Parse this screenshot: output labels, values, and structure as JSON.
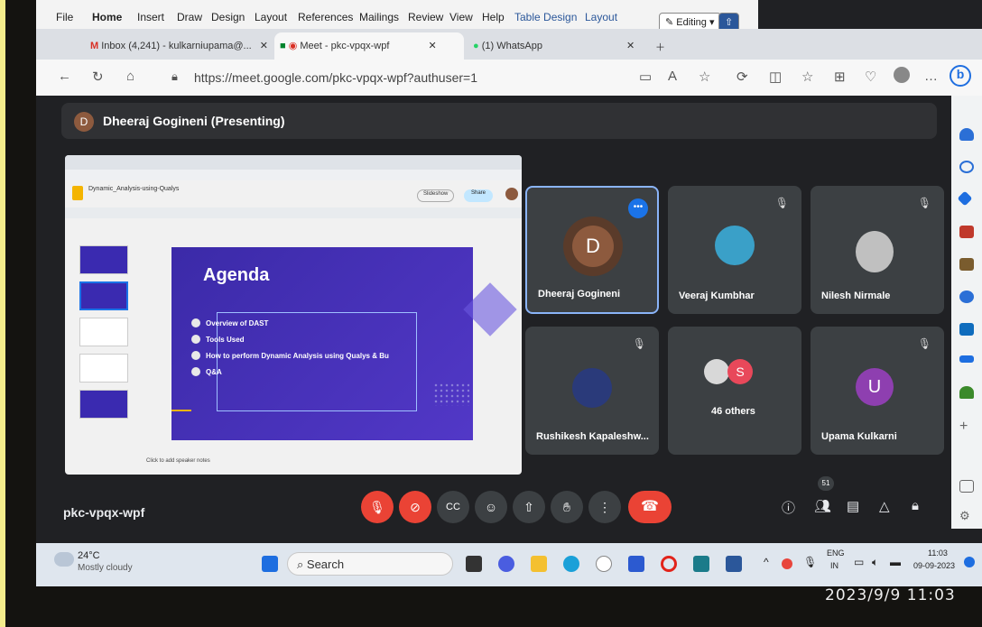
{
  "word_ribbon": {
    "menus": [
      "File",
      "Home",
      "Insert",
      "Draw",
      "Design",
      "Layout",
      "References",
      "Mailings",
      "Review",
      "View",
      "Help",
      "Table Design",
      "Layout"
    ],
    "editing_label": "Editing"
  },
  "browser": {
    "tabs": [
      {
        "label": "Inbox (4,241) - kulkarniupama@...",
        "active": false
      },
      {
        "label": "Meet - pkc-vpqx-wpf",
        "active": true
      },
      {
        "label": "(1) WhatsApp",
        "active": false
      }
    ],
    "url": "https://meet.google.com/pkc-vpqx-wpf?authuser=1"
  },
  "meet": {
    "presenter_initial": "D",
    "presenter_banner": "Dheeraj Gogineni (Presenting)",
    "meeting_code": "pkc-vpqx-wpf",
    "participant_count_badge": "51",
    "presentation": {
      "doc_title": "Dynamic_Analysis-using-Qualys",
      "slide_title": "Agenda",
      "bullets": [
        "Overview of DAST",
        "Tools Used",
        "How to perform Dynamic Analysis using Qualys & Bu",
        "Q&A"
      ],
      "slideshow_label": "Slideshow",
      "share_label": "Share",
      "notes_placeholder": "Click to add speaker notes"
    },
    "tiles": [
      {
        "name": "Dheeraj Gogineni",
        "initial": "D",
        "color": "#8d5a3e",
        "active": true
      },
      {
        "name": "Veeraj Kumbhar",
        "initial": "",
        "color": "#3aa0c8",
        "muted": true
      },
      {
        "name": "Nilesh Nirmale",
        "initial": "",
        "color": "#c0c0c0",
        "muted": true
      },
      {
        "name": "Rushikesh Kapaleshw...",
        "initial": "",
        "color": "#2a3a7a",
        "muted": true
      },
      {
        "name": "46 others",
        "initial": "S",
        "color": "#e8485a"
      },
      {
        "name": "Upama Kulkarni",
        "initial": "U",
        "color": "#8e3fb0",
        "muted": true
      }
    ]
  },
  "taskbar": {
    "weather_temp": "24°C",
    "weather_desc": "Mostly cloudy",
    "search_label": "Search",
    "lang": "ENG",
    "region": "IN",
    "time": "11:03",
    "date": "09-09-2023"
  },
  "camera_timestamp": "2023/9/9 11:03",
  "colors": {
    "meet_bg": "#202124",
    "tile_bg": "#3c4043",
    "red": "#ea4335",
    "active_border": "#8ab4f8"
  }
}
